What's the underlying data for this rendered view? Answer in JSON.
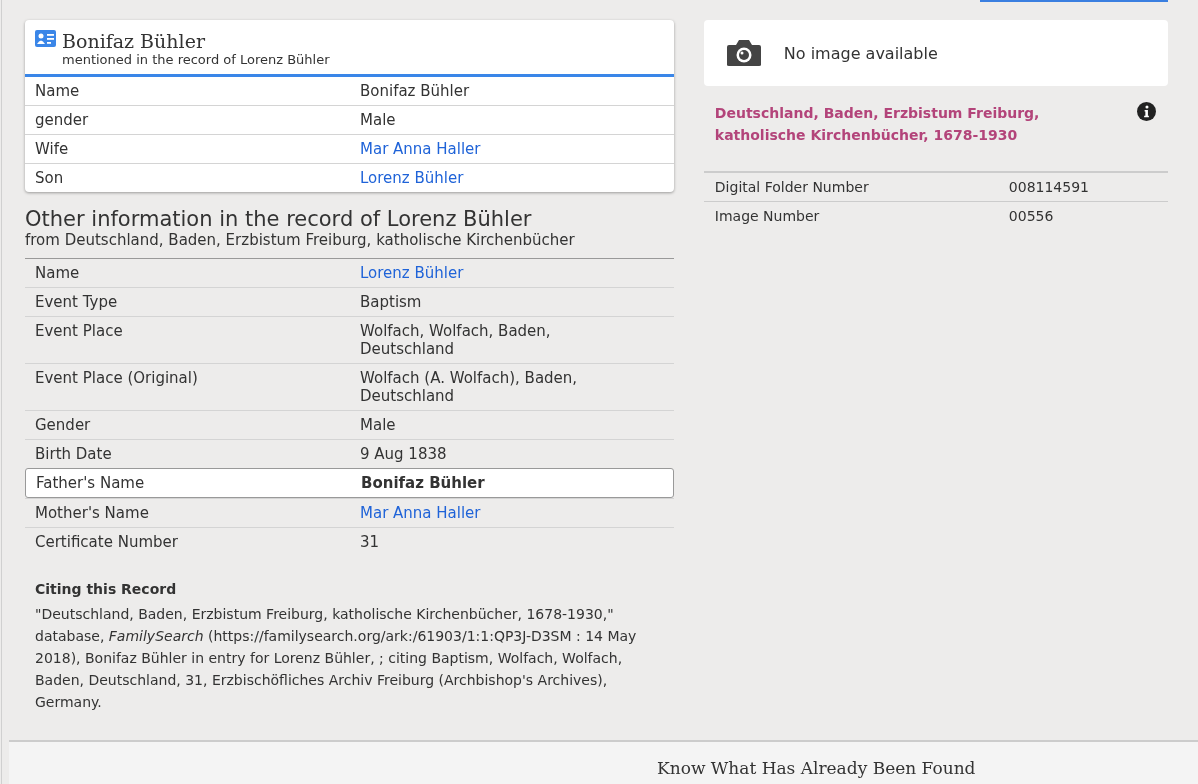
{
  "person_card": {
    "title": "Bonifaz Bühler",
    "subtitle": "mentioned in the record of Lorenz Bühler",
    "rows": [
      {
        "label": "Name",
        "value": "Bonifaz Bühler",
        "link": false
      },
      {
        "label": "gender",
        "value": "Male",
        "link": false
      },
      {
        "label": "Wife",
        "value": "Mar Anna Haller",
        "link": true
      },
      {
        "label": "Son",
        "value": "Lorenz Bühler",
        "link": true
      }
    ]
  },
  "other_info": {
    "title": "Other information in the record of Lorenz Bühler",
    "subtitle": "from Deutschland, Baden, Erzbistum Freiburg, katholische Kirchenbücher",
    "rows": [
      {
        "label": "Name",
        "value": "Lorenz Bühler",
        "link": true,
        "selected": false
      },
      {
        "label": "Event Type",
        "value": "Baptism",
        "link": false,
        "selected": false
      },
      {
        "label": "Event Place",
        "value": "Wolfach, Wolfach, Baden, Deutschland",
        "link": false,
        "selected": false
      },
      {
        "label": "Event Place (Original)",
        "value": "Wolfach (A. Wolfach), Baden, Deutschland",
        "link": false,
        "selected": false
      },
      {
        "label": "Gender",
        "value": "Male",
        "link": false,
        "selected": false
      },
      {
        "label": "Birth Date",
        "value": "9 Aug 1838",
        "link": false,
        "selected": false
      },
      {
        "label": "Father's Name",
        "value": "Bonifaz Bühler",
        "link": false,
        "selected": true
      },
      {
        "label": "Mother's Name",
        "value": "Mar Anna Haller",
        "link": true,
        "selected": false
      },
      {
        "label": "Certificate Number",
        "value": "31",
        "link": false,
        "selected": false
      }
    ]
  },
  "citation": {
    "heading": "Citing this Record",
    "text": "\"Deutschland, Baden, Erzbistum Freiburg, katholische Kirchenbücher, 1678-1930,\" database, *FamilySearch* (https://familysearch.org/ark:/61903/1:1:QP3J-D3SM : 14 May 2018), Bonifaz Bühler in entry for Lorenz Bühler, ; citing Baptism, Wolfach, Wolfach, Baden, Deutschland, 31, Erzbischöfliches Archiv Freiburg (Archbishop's Archives), Germany."
  },
  "image_panel": {
    "message": "No image available"
  },
  "collection": {
    "title": "Deutschland, Baden, Erzbistum Freiburg, katholische Kirchenbücher, 1678-1930",
    "rows": [
      {
        "label": "Digital Folder Number",
        "value": "008114591"
      },
      {
        "label": "Image Number",
        "value": "00556"
      }
    ]
  },
  "footer": {
    "heading": "Know What Has Already Been Found"
  }
}
